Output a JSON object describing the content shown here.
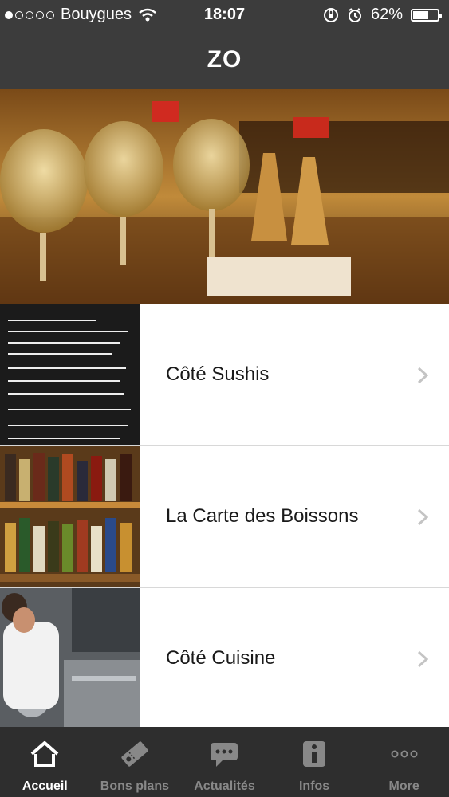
{
  "status_bar": {
    "carrier": "Bouygues",
    "time": "18:07",
    "battery": "62%",
    "battery_level": 0.62,
    "signal_bars_filled": 1,
    "signal_bars_total": 5
  },
  "nav": {
    "title": "ZO"
  },
  "hero": {
    "icon": "restaurant-photo"
  },
  "list": {
    "items": [
      {
        "label": "Côté Sushis",
        "icon": "menu-board-photo"
      },
      {
        "label": "La Carte des Boissons",
        "icon": "bottles-photo"
      },
      {
        "label": "Côté Cuisine",
        "icon": "kitchen-photo"
      }
    ]
  },
  "tabbar": {
    "tabs": [
      {
        "label": "Accueil",
        "icon": "home-icon",
        "active": true
      },
      {
        "label": "Bons plans",
        "icon": "coupon-icon",
        "active": false
      },
      {
        "label": "Actualités",
        "icon": "chat-icon",
        "active": false
      },
      {
        "label": "Infos",
        "icon": "info-icon",
        "active": false
      },
      {
        "label": "More",
        "icon": "more-icon",
        "active": false
      }
    ]
  },
  "colors": {
    "bar": "#3c3c3c",
    "tabbar": "#2e2e2e",
    "active": "#ffffff",
    "inactive": "#888888"
  }
}
